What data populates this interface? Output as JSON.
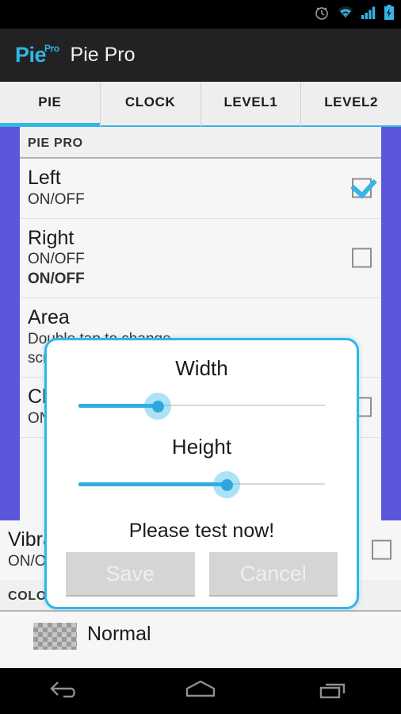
{
  "statusbar": {
    "icons": [
      "alarm-clock-icon",
      "wifi-icon",
      "cell-signal-icon",
      "battery-charging-icon"
    ]
  },
  "actionbar": {
    "logo_main": "Pie",
    "logo_sup": "Pro",
    "title": "Pie Pro"
  },
  "tabs": [
    {
      "label": "PIE",
      "active": true
    },
    {
      "label": "CLOCK",
      "active": false
    },
    {
      "label": "LEVEL1",
      "active": false
    },
    {
      "label": "LEVEL2",
      "active": false
    }
  ],
  "list": {
    "section_header": "PIE PRO",
    "rows": [
      {
        "title": "Left",
        "summary": "ON/OFF",
        "checked": true
      },
      {
        "title": "Right",
        "summary": "ON/OFF",
        "summary2": "ON/OFF",
        "checked": false
      },
      {
        "title": "Area",
        "summary": "Double tap to change",
        "summary2": "screen area",
        "checked": false
      },
      {
        "title": "Click",
        "summary": "ON/OFF",
        "checked": false
      },
      {
        "title": "Vibration",
        "summary": "ON/OFF",
        "checked": false
      }
    ],
    "color_header": "COLOR",
    "color_item": {
      "label": "Normal",
      "swatch": "transparent-checker-swatch"
    }
  },
  "dialog": {
    "width_label": "Width",
    "width_value": 32,
    "height_label": "Height",
    "height_value": 60,
    "message": "Please test now!",
    "save_label": "Save",
    "cancel_label": "Cancel"
  },
  "navbar": {
    "back_label": "back-icon",
    "home_label": "home-icon",
    "recents_label": "recents-icon"
  },
  "colors": {
    "accent": "#33b5e5",
    "edge_bar": "#5b57dd",
    "actionbar": "#222224",
    "list_bg": "#f6f6f6"
  }
}
